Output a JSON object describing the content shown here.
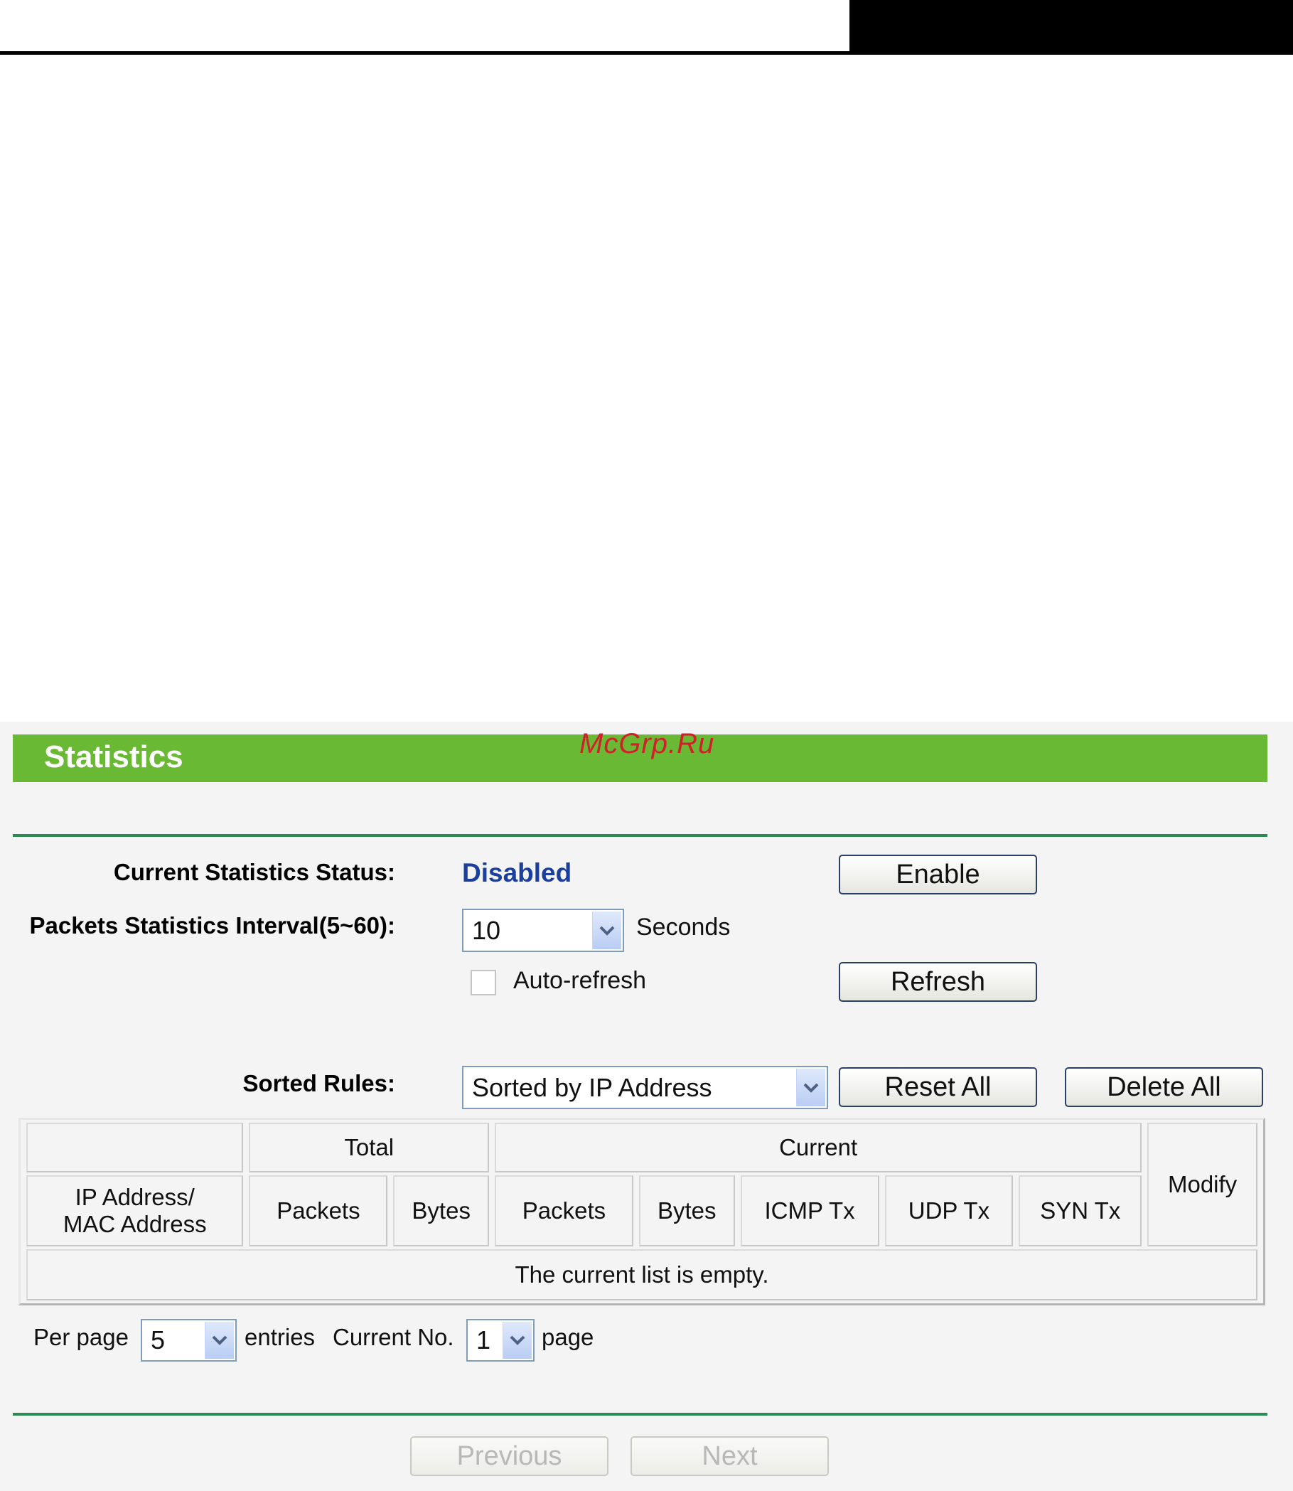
{
  "page": {
    "title": "Statistics",
    "watermark": "McGrp.Ru"
  },
  "status_row": {
    "label": "Current Statistics Status:",
    "value": "Disabled",
    "enable_button": "Enable"
  },
  "interval_row": {
    "label": "Packets Statistics Interval(5~60):",
    "value": "10",
    "unit": "Seconds"
  },
  "refresh_row": {
    "auto_refresh_label": "Auto-refresh",
    "auto_refresh_checked": false,
    "refresh_button": "Refresh"
  },
  "sort_row": {
    "label": "Sorted Rules:",
    "value": "Sorted by IP Address",
    "reset_all_button": "Reset All",
    "delete_all_button": "Delete All"
  },
  "table": {
    "group_headers": {
      "total": "Total",
      "current": "Current",
      "modify": "Modify"
    },
    "address_header_line1": "IP Address/",
    "address_header_line2": "MAC Address",
    "columns": [
      "Packets",
      "Bytes",
      "Packets",
      "Bytes",
      "ICMP Tx",
      "UDP Tx",
      "SYN Tx"
    ],
    "empty_message": "The current list is empty."
  },
  "pager": {
    "per_page_label": "Per page",
    "per_page_value": "5",
    "entries_label": "entries",
    "current_no_label": "Current No.",
    "current_no_value": "1",
    "page_label": "page",
    "previous_button": "Previous",
    "next_button": "Next"
  },
  "colors": {
    "header_green": "#69b934",
    "divider_green": "#2d8a53",
    "status_blue": "#1a3f9e",
    "watermark_red": "#d0202a"
  },
  "icons": [
    "chevron-down-icon"
  ]
}
